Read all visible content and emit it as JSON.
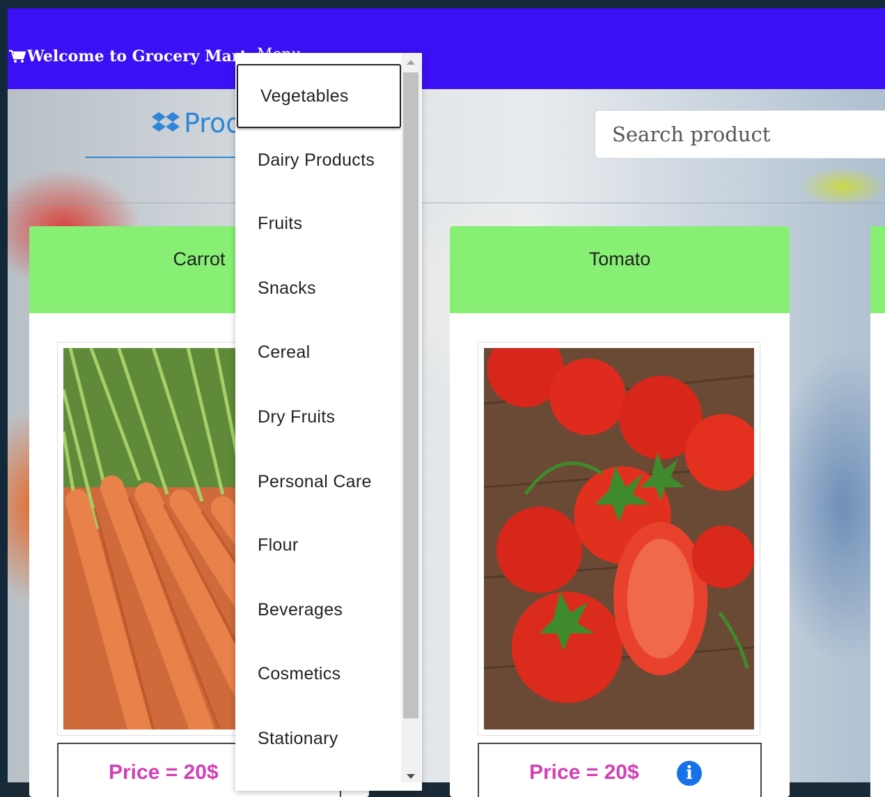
{
  "navbar": {
    "brand": "Welcome to Grocery Mart",
    "menu_label": "Menu"
  },
  "page": {
    "heading": "Products",
    "search_placeholder": "Search product"
  },
  "menu": {
    "items": [
      "Vegetables",
      "Dairy Products",
      "Fruits",
      "Snacks",
      "Cereal",
      "Dry Fruits",
      "Personal Care",
      "Flour",
      "Beverages",
      "Cosmetics",
      "Stationary"
    ],
    "active_index": 0
  },
  "products": [
    {
      "name": "Carrot",
      "price": "Price = 20$"
    },
    {
      "name": "Tomato",
      "price": "Price = 20$"
    }
  ],
  "colors": {
    "navbar": "#3b10f5",
    "card_header": "#86ef74",
    "price": "#d43fb5",
    "info": "#1672e8",
    "heading": "#2f86d8"
  },
  "icons": [
    "cart-icon",
    "caret-down-icon",
    "dropbox-icon",
    "info-icon"
  ]
}
